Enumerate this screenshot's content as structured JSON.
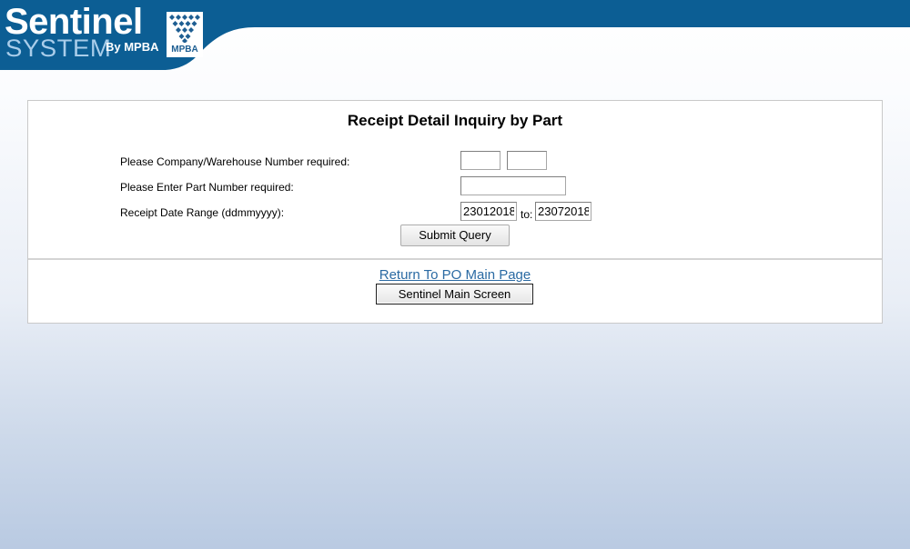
{
  "brand": {
    "name": "Sentinel",
    "system": "SYSTEM",
    "by": "By MPBA",
    "badge": "MPBA"
  },
  "colors": {
    "header_blue": "#0c5e94",
    "system_text": "#a9cdea",
    "link": "#2a6aa3"
  },
  "form": {
    "title": "Receipt Detail Inquiry by Part",
    "company_warehouse_label": "Please Company/Warehouse Number required:",
    "company_value": "",
    "warehouse_value": "",
    "part_label": "Please Enter Part Number required:",
    "part_value": "",
    "date_range_label": "Receipt Date Range (ddmmyyyy):",
    "date_from": "23012018",
    "to_label": "to:",
    "date_to": "23072018",
    "submit_label": "Submit Query"
  },
  "nav": {
    "return_link": "Return To PO Main Page",
    "main_screen_button": "Sentinel Main Screen"
  }
}
